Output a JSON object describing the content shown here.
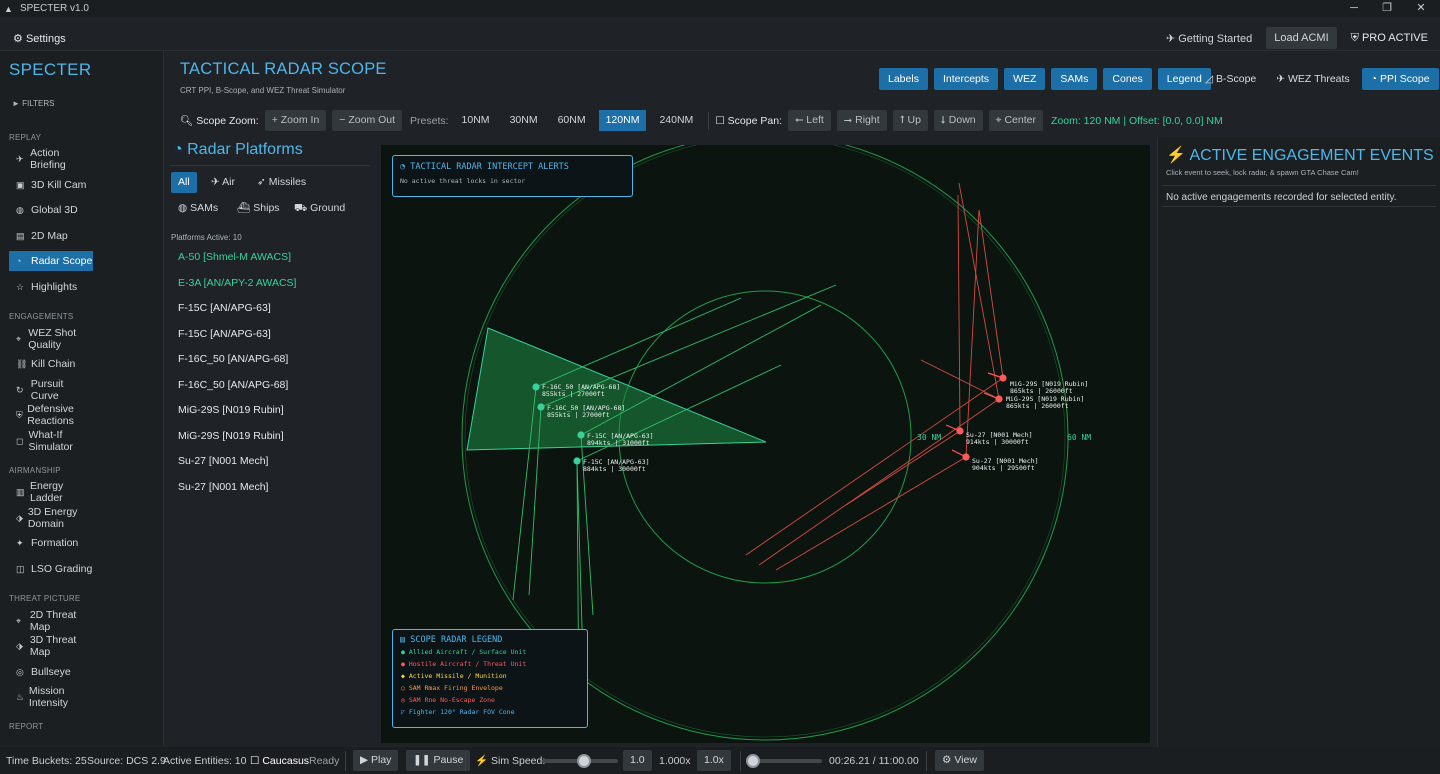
{
  "window": {
    "title": "SPECTER v1.0",
    "minimize": "─",
    "maximize": "❐",
    "close": "✕"
  },
  "topbar": {
    "settings": "Settings",
    "getting_started": "Getting Started",
    "load_acmi": "Load ACMI",
    "pro": "PRO ACTIVE"
  },
  "sidebar": {
    "brand": "SPECTER",
    "filters": "► FILTERS",
    "sections": {
      "replay": "REPLAY",
      "engagements": "ENGAGEMENTS",
      "airmanship": "AIRMANSHIP",
      "threat": "THREAT PICTURE",
      "report": "REPORT"
    },
    "items": [
      {
        "label": "Action Briefing",
        "icon": "✈"
      },
      {
        "label": "3D Kill Cam",
        "icon": "▣"
      },
      {
        "label": "Global 3D",
        "icon": "◍"
      },
      {
        "label": "2D Map",
        "icon": "▤"
      },
      {
        "label": "Radar Scope",
        "icon": "◔"
      },
      {
        "label": "Highlights",
        "icon": "☆"
      },
      {
        "label": "WEZ Shot Quality",
        "icon": "⌖"
      },
      {
        "label": "Kill Chain",
        "icon": "⛓"
      },
      {
        "label": "Pursuit Curve",
        "icon": "↻"
      },
      {
        "label": "Defensive Reactions",
        "icon": "⛨"
      },
      {
        "label": "What-If Simulator",
        "icon": "◻"
      },
      {
        "label": "Energy Ladder",
        "icon": "▥"
      },
      {
        "label": "3D Energy Domain",
        "icon": "⬗"
      },
      {
        "label": "Formation",
        "icon": "✦"
      },
      {
        "label": "LSO Grading",
        "icon": "◫"
      },
      {
        "label": "2D Threat Map",
        "icon": "⌖"
      },
      {
        "label": "3D Threat Map",
        "icon": "⬗"
      },
      {
        "label": "Bullseye",
        "icon": "◎"
      },
      {
        "label": "Mission Intensity",
        "icon": "♨"
      }
    ]
  },
  "header": {
    "title": "TACTICAL RADAR SCOPE",
    "subtitle": "CRT PPI, B-Scope, and WEZ Threat Simulator"
  },
  "toggles": [
    "Labels",
    "Intercepts",
    "WEZ",
    "SAMs",
    "Cones",
    "Legend"
  ],
  "views": {
    "bscope": "B-Scope",
    "wez": "WEZ Threats",
    "ppi": "PPI Scope"
  },
  "zoombar": {
    "scope_zoom": "Scope Zoom:",
    "zoom_in": "+ Zoom In",
    "zoom_out": "− Zoom Out",
    "presets": "Presets:",
    "preset_items": [
      "10NM",
      "30NM",
      "60NM",
      "120NM",
      "240NM"
    ],
    "active_preset": "120NM",
    "scope_pan": "Scope Pan:",
    "left": "⭠ Left",
    "right": "⭢ Right",
    "up": "⭡ Up",
    "down": "⭣ Down",
    "center": "Center",
    "info": "Zoom: 120 NM | Offset: [0.0, 0.0] NM"
  },
  "platforms": {
    "title": "Radar Platforms",
    "filters": [
      "All",
      "Air",
      "Missiles",
      "SAMs",
      "Ships",
      "Ground"
    ],
    "active_count": "Platforms Active: 10",
    "items": [
      {
        "name": "A-50 [Shmel-M AWACS]",
        "ally": true
      },
      {
        "name": "E-3A [AN/APY-2 AWACS]",
        "ally": true
      },
      {
        "name": "F-15C [AN/APG-63]",
        "ally": false
      },
      {
        "name": "F-15C [AN/APG-63]",
        "ally": false
      },
      {
        "name": "F-16C_50 [AN/APG-68]",
        "ally": false
      },
      {
        "name": "F-16C_50 [AN/APG-68]",
        "ally": false
      },
      {
        "name": "MiG-29S [N019 Rubin]",
        "ally": false
      },
      {
        "name": "MiG-29S [N019 Rubin]",
        "ally": false
      },
      {
        "name": "Su-27 [N001 Mech]",
        "ally": false
      },
      {
        "name": "Su-27 [N001 Mech]",
        "ally": false
      }
    ]
  },
  "radar": {
    "ring_labels": [
      "30 NM",
      "60 NM"
    ],
    "alerts": {
      "title": "TACTICAL RADAR INTERCEPT ALERTS",
      "text": "No active threat locks in sector"
    },
    "legend": {
      "title": "SCOPE RADAR LEGEND",
      "items": [
        {
          "text": "● Allied Aircraft / Surface Unit",
          "color": "#38d19a"
        },
        {
          "text": "● Hostile Aircraft / Threat Unit",
          "color": "#ff5a5a"
        },
        {
          "text": "◆ Active Missile / Munition",
          "color": "#ffd84a"
        },
        {
          "text": "○ SAM Rmax Firing Envelope",
          "color": "#ff9a3a"
        },
        {
          "text": "◎ SAM Rne No-Escape Zone",
          "color": "#ff5a5a"
        },
        {
          "text": "◸ Fighter 120° Radar FOV Cone",
          "color": "#4fb6ea"
        }
      ]
    },
    "contacts": [
      {
        "name": "F-16C_50 [AN/APG-68]",
        "info": "855kts | 27000ft",
        "side": "ally"
      },
      {
        "name": "F-16C_50 [AN/APG-68]",
        "info": "855kts | 27000ft",
        "side": "ally"
      },
      {
        "name": "F-15C [AN/APG-63]",
        "info": "894kts | 31000ft",
        "side": "ally"
      },
      {
        "name": "F-15C [AN/APG-63]",
        "info": "884kts | 30000ft",
        "side": "ally"
      },
      {
        "name": "MiG-29S [N019 Rubin]",
        "info": "865kts | 26000ft",
        "side": "hostile"
      },
      {
        "name": "MiG-29S [N019 Rubin]",
        "info": "865kts | 26000ft",
        "side": "hostile"
      },
      {
        "name": "Su-27 [N001 Mech]",
        "info": "914kts | 30000ft",
        "side": "hostile"
      },
      {
        "name": "Su-27 [N001 Mech]",
        "info": "904kts | 29500ft",
        "side": "hostile"
      }
    ]
  },
  "engagements": {
    "title": "ACTIVE ENGAGEMENT EVENTS",
    "subtitle": "Click event to seek, lock radar, & spawn GTA Chase Cam!",
    "empty": "No active engagements recorded for selected entity."
  },
  "status": {
    "time_buckets": "Time Buckets: 25",
    "source": "Source: DCS 2.9",
    "active": "Active Entities: 10",
    "map": "Caucasus",
    "ready": "Ready",
    "play": "▶ Play",
    "pause": "❚❚ Pause",
    "sim_speed": "Sim Speed:",
    "speed_box": "1.0",
    "speed_val": "1.000x",
    "speed_btn": "1.0x",
    "time": "00:26.21 / 11:00.00",
    "view": "View",
    "sim_speed_fraction": 0.55,
    "timeline_fraction": 0.04
  },
  "colors": {
    "accent": "#4fb6ea",
    "primary_button": "#1c6fa7",
    "ally": "#38d19a",
    "hostile": "#ff5a5a",
    "scope_green": "#1f9a4a"
  }
}
